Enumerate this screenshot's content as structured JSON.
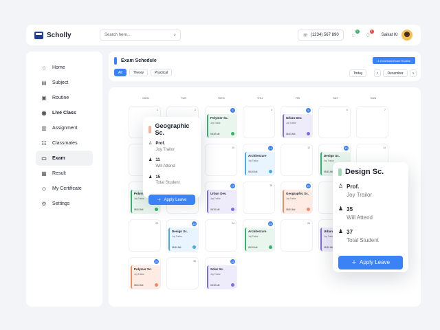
{
  "brand": {
    "name": "Scholly"
  },
  "search": {
    "placeholder": "Search here..."
  },
  "header": {
    "phone": "(1234) 567 890",
    "user": "Saikat Kr",
    "notif": "1",
    "alert": "1"
  },
  "sidebar": {
    "items": [
      {
        "label": "Home",
        "icon": "home-icon",
        "active": false
      },
      {
        "label": "Subject",
        "icon": "book-icon",
        "active": false
      },
      {
        "label": "Routine",
        "icon": "calendar-icon",
        "active": false
      },
      {
        "label": "Live Class",
        "icon": "live-icon",
        "active": false
      },
      {
        "label": "Assignment",
        "icon": "document-icon",
        "active": false
      },
      {
        "label": "Classmates",
        "icon": "users-icon",
        "active": false
      },
      {
        "label": "Exam",
        "icon": "clipboard-icon",
        "active": true
      },
      {
        "label": "Result",
        "icon": "result-icon",
        "active": false
      },
      {
        "label": "My Certificate",
        "icon": "certificate-icon",
        "active": false
      },
      {
        "label": "Settings",
        "icon": "gear-icon",
        "active": false
      }
    ]
  },
  "exam": {
    "title": "Exam Schedule",
    "download": "Download Exam Routine",
    "filters": [
      "All",
      "Theory",
      "Practical"
    ],
    "today": "Today",
    "month": "December"
  },
  "calendar": {
    "days": [
      "MON",
      "TUE",
      "WED",
      "THU",
      "FRI",
      "SAT",
      "SUN"
    ],
    "events": [
      {
        "name": "Polymer Sc.",
        "prof": "Joy Trailor",
        "time": "08:30 AM",
        "color": "green"
      },
      {
        "name": "Urban Dev.",
        "prof": "Joy Trailor",
        "time": "08:30 AM",
        "color": "purple"
      },
      {
        "name": "Architecture",
        "prof": "Joy Trailor",
        "time": "08:30 AM",
        "color": "blue"
      },
      {
        "name": "Design Sc.",
        "prof": "Joy Trailor",
        "time": "08:30 AM",
        "color": "green"
      },
      {
        "name": "Polymer",
        "prof": "Joy Trailor",
        "time": "08:30 AM",
        "color": "green"
      },
      {
        "name": "Urban Dev.",
        "prof": "Joy Trailor",
        "time": "08:30 AM",
        "color": "purple"
      },
      {
        "name": "Geographic Sc.",
        "prof": "Joy Trailor",
        "time": "08:30 AM",
        "color": "orange"
      },
      {
        "name": "Design Sc.",
        "prof": "Joy Trailor",
        "time": "08:30 AM",
        "color": "blue"
      },
      {
        "name": "Architecture",
        "prof": "Joy Trailor",
        "time": "08:30 AM",
        "color": "green"
      },
      {
        "name": "Urban",
        "prof": "Joy Trailor",
        "time": "08:30 AM",
        "color": "purple"
      },
      {
        "name": "Polymer Sc.",
        "prof": "Joy Trailor",
        "time": "08:30 AM",
        "color": "orange"
      },
      {
        "name": "Solar Sc.",
        "prof": "Joy Trailor",
        "time": "08:30 AM",
        "color": "purple"
      }
    ]
  },
  "popup1": {
    "title": "Geographic Sc.",
    "prof_title": "Prof.",
    "prof": "Joy Trailor",
    "attend": "11",
    "attend_label": "Will Attend",
    "total": "15",
    "total_label": "Total Student",
    "button": "Apply Leave"
  },
  "popup2": {
    "title": "Design Sc.",
    "prof_title": "Prof.",
    "prof": "Joy Trailor",
    "attend": "35",
    "attend_label": "Will Attend",
    "total": "37",
    "total_label": "Total Student",
    "button": "Apply Leave"
  }
}
